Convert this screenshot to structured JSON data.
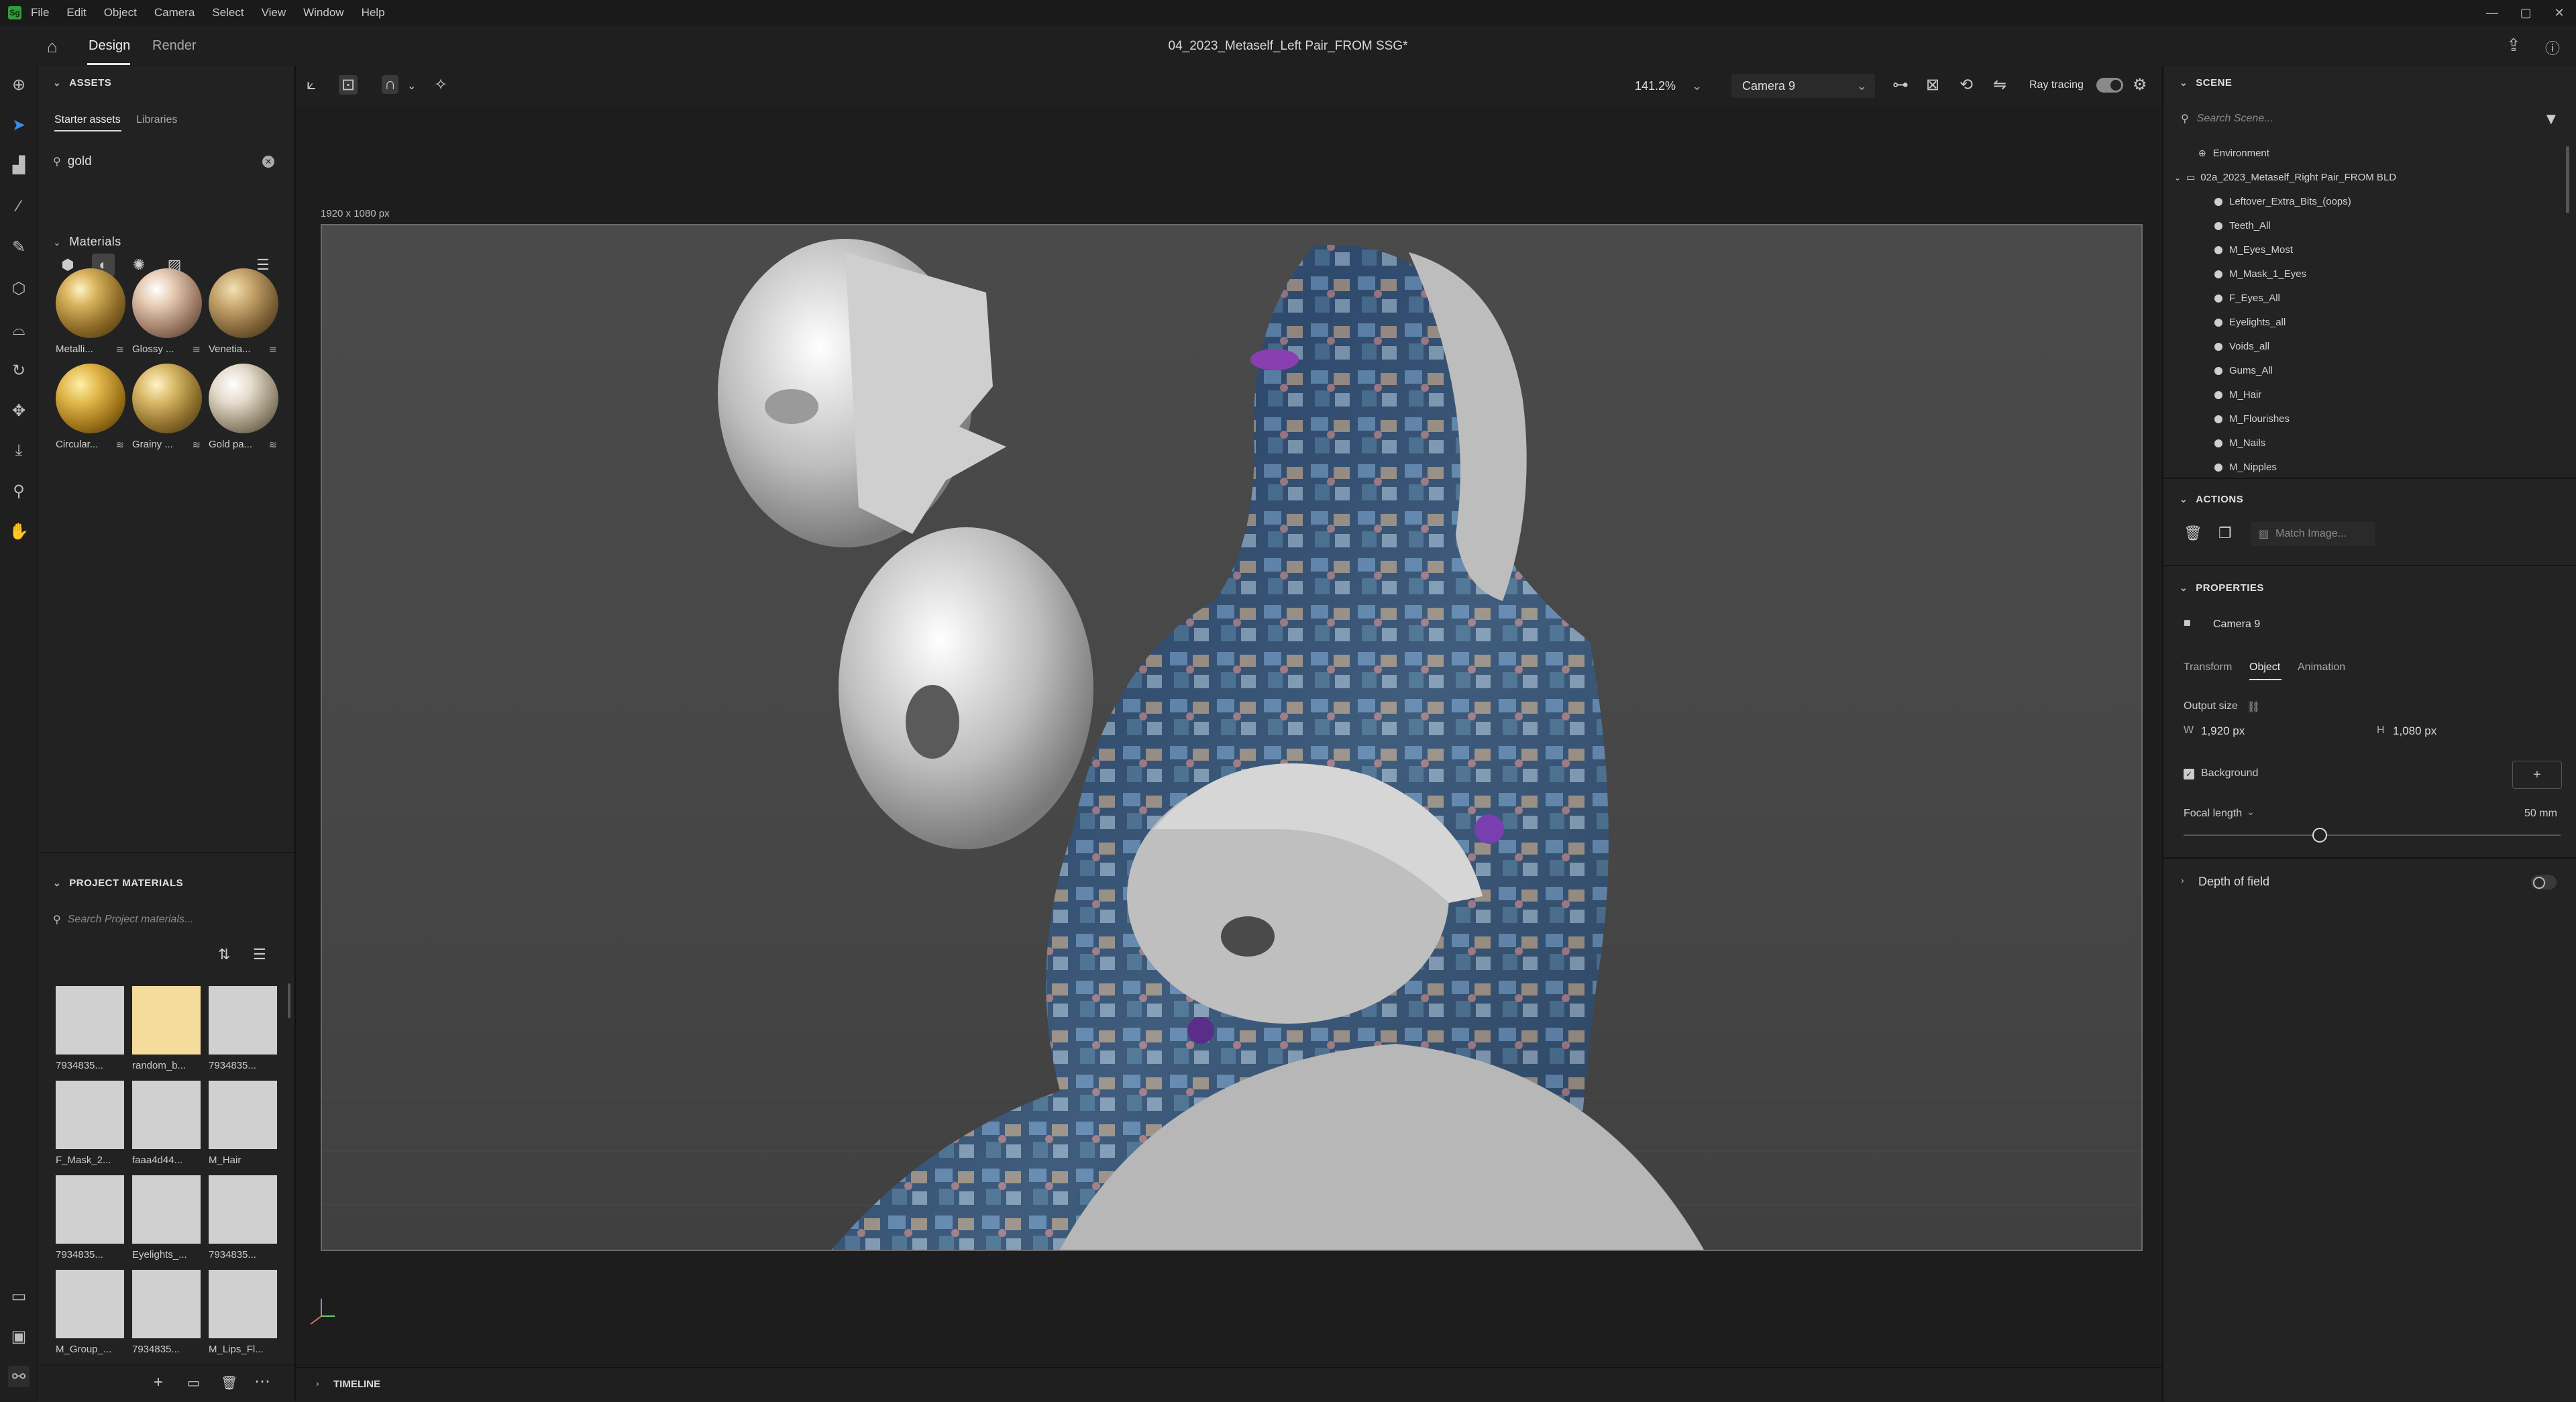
{
  "menubar": {
    "logo": "Sg",
    "items": [
      "File",
      "Edit",
      "Object",
      "Camera",
      "Select",
      "View",
      "Window",
      "Help"
    ],
    "window_controls": [
      "—",
      "▢",
      "✕"
    ]
  },
  "header": {
    "tabs": [
      "Design",
      "Render"
    ],
    "title": "04_2023_Metaself_Left Pair_FROM SSG*"
  },
  "assets": {
    "section_title": "ASSETS",
    "subtabs": [
      "Starter assets",
      "Libraries"
    ],
    "search_value": "gold",
    "materials_title": "Materials",
    "materials": [
      {
        "label": "Metalli...",
        "gradient": "radial-gradient(circle at 35% 30%,#fff3c6 0%,#d8b25c 25%,#8c6a26 60%,#3a2a0e 100%)"
      },
      {
        "label": "Glossy ...",
        "gradient": "radial-gradient(circle at 35% 30%,#ffffff 0%,#e8cdb6 25%,#a07d66 60%,#3b2b24 100%)"
      },
      {
        "label": "Venetia...",
        "gradient": "radial-gradient(circle at 35% 30%,#f2e1b4 0%,#c4a26a 30%,#7a5f34 65%,#33240f 100%)"
      },
      {
        "label": "Circular...",
        "gradient": "radial-gradient(circle at 35% 30%,#fff0a8 0%,#e0b548 30%,#9a7018 65%,#3e2a05 100%)"
      },
      {
        "label": "Grainy ...",
        "gradient": "radial-gradient(circle at 35% 30%,#fff4c8 0%,#d8b866 28%,#8e6f2c 62%,#3a2b10 100%)"
      },
      {
        "label": "Gold pa...",
        "gradient": "radial-gradient(circle at 35% 30%,#ffffff 0%,#e4dccb 28%,#9a8f78 62%,#3a342a 100%)"
      }
    ],
    "project_title": "PROJECT MATERIALS",
    "project_search_placeholder": "Search Project materials...",
    "project_materials": [
      {
        "label": "7934835...",
        "color": "#d0d0d0"
      },
      {
        "label": "random_b...",
        "color": "#f6dc9c"
      },
      {
        "label": "7934835...",
        "color": "#d0d0d0"
      },
      {
        "label": "F_Mask_2...",
        "color": "#d0d0d0"
      },
      {
        "label": "faaa4d44...",
        "color": "#d0d0d0"
      },
      {
        "label": "M_Hair",
        "color": "#d0d0d0"
      },
      {
        "label": "7934835...",
        "color": "#d0d0d0"
      },
      {
        "label": "Eyelights_...",
        "color": "#d0d0d0"
      },
      {
        "label": "7934835...",
        "color": "#d0d0d0"
      },
      {
        "label": "M_Group_...",
        "color": "#d0d0d0"
      },
      {
        "label": "7934835...",
        "color": "#d0d0d0"
      },
      {
        "label": "M_Lips_Fl...",
        "color": "#d0d0d0"
      }
    ]
  },
  "viewport": {
    "zoom": "141.2%",
    "camera": "Camera 9",
    "ray_tracing_label": "Ray tracing",
    "canvas_size_label": "1920 x 1080 px",
    "timeline_label": "TIMELINE"
  },
  "scene": {
    "title": "SCENE",
    "search_placeholder": "Search Scene...",
    "environment": "Environment",
    "group": "02a_2023_Metaself_Right Pair_FROM BLD",
    "items": [
      "Leftover_Extra_Bits_(oops)",
      "Teeth_All",
      "M_Eyes_Most",
      "M_Mask_1_Eyes",
      "F_Eyes_All",
      "Eyelights_all",
      "Voids_all",
      "Gums_All",
      "M_Hair",
      "M_Flourishes",
      "M_Nails",
      "M_Nipples"
    ]
  },
  "actions": {
    "title": "ACTIONS",
    "match_image": "Match Image..."
  },
  "properties": {
    "title": "PROPERTIES",
    "object_name": "Camera 9",
    "tabs": [
      "Transform",
      "Object",
      "Animation"
    ],
    "output_size_label": "Output size",
    "width_label": "W",
    "width_value": "1,920 px",
    "height_label": "H",
    "height_value": "1,080 px",
    "background_label": "Background",
    "focal_length_label": "Focal length",
    "focal_length_value": "50 mm",
    "depth_of_field_label": "Depth of field"
  }
}
